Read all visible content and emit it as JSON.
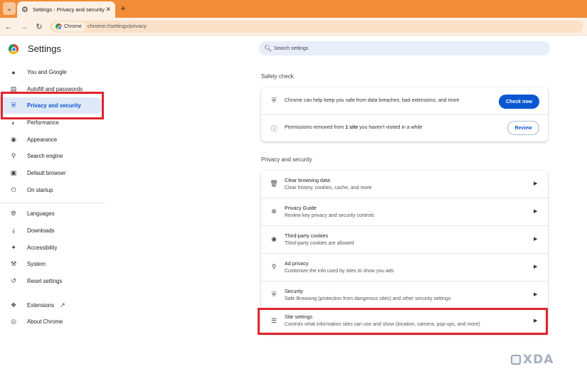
{
  "window": {
    "tab_title": "Settings - Privacy and security",
    "tab_icon": "gear-icon",
    "new_tab_label": "+",
    "url_chip": "Chrome",
    "url": "chrome://settings/privacy"
  },
  "header": {
    "title": "Settings",
    "search_placeholder": "Search settings"
  },
  "sidebar": {
    "items": [
      {
        "label": "You and Google",
        "icon": "person-icon"
      },
      {
        "label": "Autofill and passwords",
        "icon": "clipboard-icon"
      },
      {
        "label": "Privacy and security",
        "icon": "shield-icon",
        "active": true
      },
      {
        "label": "Performance",
        "icon": "speedometer-icon"
      },
      {
        "label": "Appearance",
        "icon": "palette-icon"
      },
      {
        "label": "Search engine",
        "icon": "search-icon"
      },
      {
        "label": "Default browser",
        "icon": "browser-icon"
      },
      {
        "label": "On startup",
        "icon": "power-icon"
      },
      {
        "label": "Languages",
        "icon": "globe-icon"
      },
      {
        "label": "Downloads",
        "icon": "download-icon"
      },
      {
        "label": "Accessibility",
        "icon": "accessibility-icon"
      },
      {
        "label": "System",
        "icon": "wrench-icon"
      },
      {
        "label": "Reset settings",
        "icon": "history-icon"
      },
      {
        "label": "Extensions",
        "icon": "puzzle-icon"
      },
      {
        "label": "About Chrome",
        "icon": "chrome-icon"
      }
    ]
  },
  "safety_check": {
    "heading": "Safety check",
    "row1_text": "Chrome can help keep you safe from data breaches, bad extensions, and more",
    "row1_button": "Check now",
    "row2_prefix": "Permissions removed from ",
    "row2_bold": "1 site",
    "row2_suffix": " you haven't visited in a while",
    "row2_button": "Review"
  },
  "privacy": {
    "heading": "Privacy and security",
    "rows": [
      {
        "title": "Clear browsing data",
        "subtitle": "Clear history, cookies, cache, and more",
        "icon": "trash-icon"
      },
      {
        "title": "Privacy Guide",
        "subtitle": "Review key privacy and security controls",
        "icon": "compass-icon"
      },
      {
        "title": "Third-party cookies",
        "subtitle": "Third-party cookies are allowed",
        "icon": "cookie-icon"
      },
      {
        "title": "Ad privacy",
        "subtitle": "Customize the info used by sites to show you ads",
        "icon": "ad-privacy-icon"
      },
      {
        "title": "Security",
        "subtitle": "Safe Browsing (protection from dangerous sites) and other security settings",
        "icon": "shield-icon"
      },
      {
        "title": "Site settings",
        "subtitle": "Controls what information sites can use and show (location, camera, pop-ups, and more)",
        "icon": "sliders-icon"
      }
    ]
  },
  "watermark": "XDA",
  "colors": {
    "tabstrip": "#f28c38",
    "accent": "#0b57d0",
    "highlight": "#e0242b"
  }
}
